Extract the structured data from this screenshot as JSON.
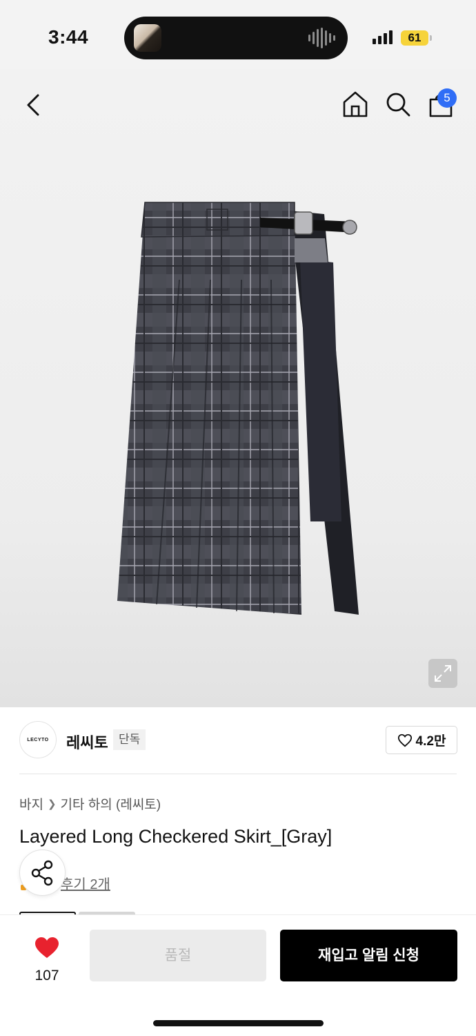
{
  "status_bar": {
    "time": "3:44",
    "battery": "61"
  },
  "nav": {
    "icons": [
      "back-icon",
      "home-icon",
      "search-icon",
      "shopping-bag-icon"
    ],
    "cart_count": "5"
  },
  "brand": {
    "logo_text": "LECYTO",
    "name": "레씨토",
    "tag": "단독",
    "likes": "4.2만"
  },
  "product": {
    "breadcrumb": [
      "바지",
      "기타 하의 (레씨토)"
    ],
    "title": "Layered Long Checkered Skirt_[Gray]",
    "reviews_text": "후기 2개"
  },
  "bottom_bar": {
    "wish_count": "107",
    "soldout_label": "품절",
    "restock_label": "재입고 알림 신청"
  },
  "colors": {
    "accent_badge": "#2f6df6",
    "heart": "#e8222e",
    "primary_button": "#000000"
  }
}
